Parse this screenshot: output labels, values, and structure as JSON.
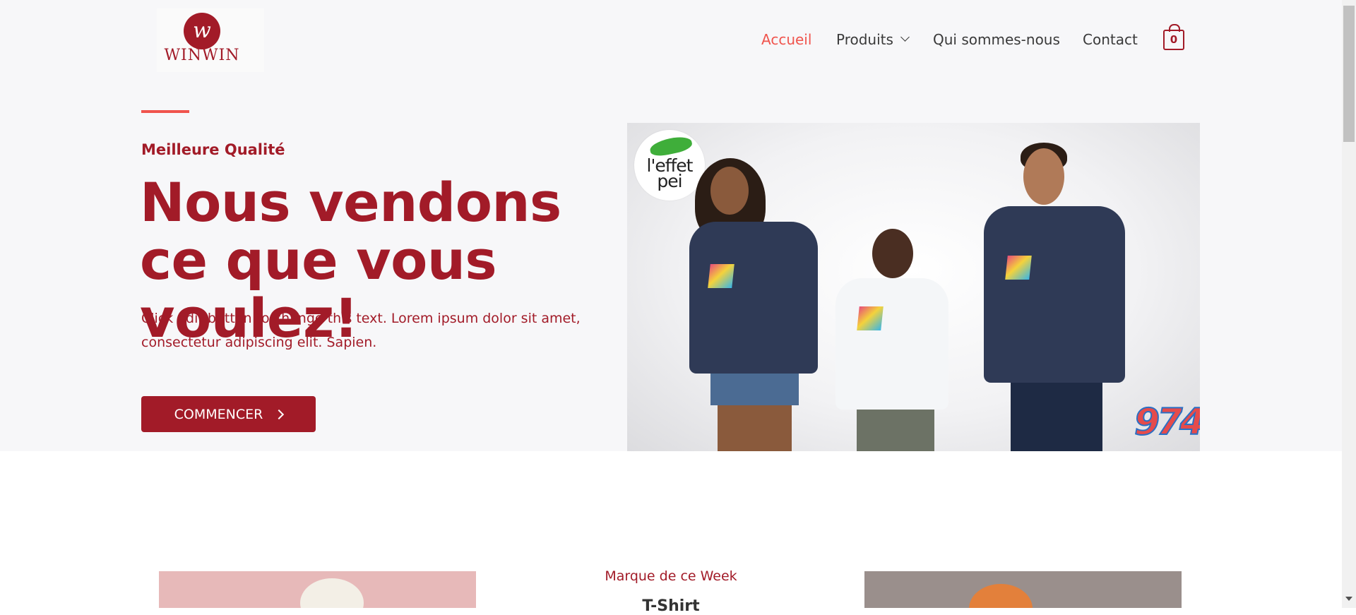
{
  "brand": {
    "logo_text": "WINWIN",
    "logo_letter": "w"
  },
  "nav": {
    "items": [
      {
        "label": "Accueil",
        "active": true
      },
      {
        "label": "Produits",
        "has_dropdown": true
      },
      {
        "label": "Qui sommes-nous"
      },
      {
        "label": "Contact"
      }
    ],
    "cart_count": "0"
  },
  "hero": {
    "eyebrow": "Meilleure Qualité",
    "headline": "Nous vendons ce que vous voulez!",
    "body": "Click edit button to change this text. Lorem ipsum dolor sit amet, consectetur adipiscing elit. Sapien.",
    "cta_label": "COMMENCER",
    "image": {
      "badge_text": "l'effet pei",
      "corner_logo_text": "974"
    }
  },
  "featured": {
    "label": "Marque de ce Week",
    "title": "T-Shirt"
  },
  "colors": {
    "brand": "#a21b28",
    "accent": "#f0544d",
    "hero_background": "#f7f7f9",
    "nav_text": "#3a3a3a"
  },
  "icons": {
    "nav_dropdown": "chevron-down-icon",
    "cart": "shopping-bag-icon",
    "cta": "chevron-right-icon"
  }
}
